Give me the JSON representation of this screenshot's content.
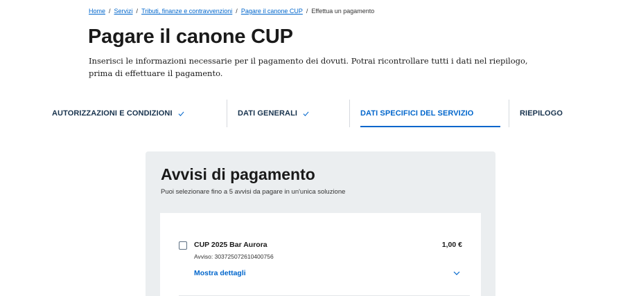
{
  "breadcrumb": {
    "items": [
      "Home",
      "Servizi",
      "Tributi, finanze e contravvenzioni",
      "Pagare il canone CUP"
    ],
    "current": "Effettua un pagamento",
    "separator": "/"
  },
  "page": {
    "title": "Pagare il canone CUP",
    "intro": "Inserisci le informazioni necessarie per il pagamento dei dovuti. Potrai ricontrollare tutti i dati nel riepilogo, prima di effettuare il pagamento."
  },
  "steps": [
    {
      "label": "AUTORIZZAZIONI E CONDIZIONI",
      "completed": true
    },
    {
      "label": "DATI GENERALI",
      "completed": true
    },
    {
      "label": "DATI SPECIFICI DEL SERVIZIO",
      "active": true
    },
    {
      "label": "RIEPILOGO"
    }
  ],
  "panel": {
    "title": "Avvisi di pagamento",
    "subtitle": "Puoi selezionare fino a 5 avvisi da pagare in un'unica soluzione",
    "notices": [
      {
        "name": "CUP 2025 Bar Aurora",
        "amount": "1,00 €",
        "notice_label": "Avviso: 303725072610400756",
        "details_link": "Mostra dettagli",
        "checked": false
      }
    ]
  },
  "colors": {
    "primary": "#0066cc",
    "heading_dark": "#17324d",
    "panel_bg": "#ebeef0"
  },
  "icons": [
    "check-icon",
    "chevron-down-icon"
  ]
}
